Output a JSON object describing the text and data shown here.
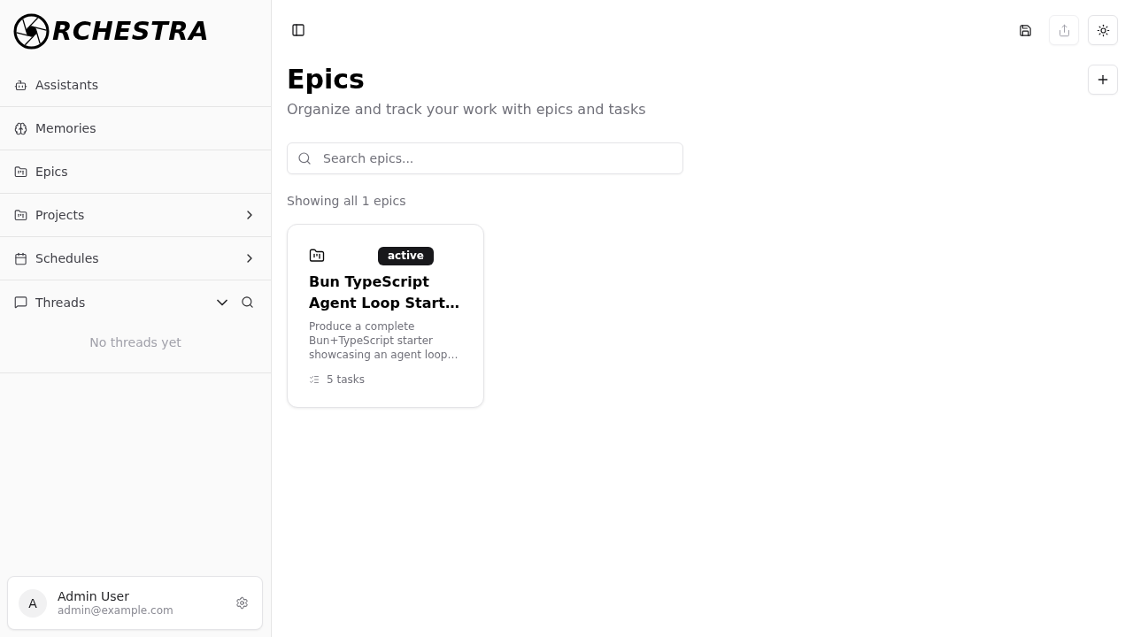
{
  "sidebar": {
    "logo": "RCHESTRA",
    "nav": [
      {
        "label": "Assistants",
        "kind": "link"
      },
      {
        "label": "Memories",
        "kind": "link"
      },
      {
        "label": "Epics",
        "kind": "link"
      },
      {
        "label": "Projects",
        "kind": "group",
        "expanded": false
      },
      {
        "label": "Schedules",
        "kind": "group",
        "expanded": false
      },
      {
        "label": "Threads",
        "kind": "section",
        "expanded": true,
        "empty_text": "No threads yet"
      }
    ],
    "user": {
      "initial": "A",
      "name": "Admin User",
      "email": "admin@example.com"
    }
  },
  "toolbar": [
    {
      "kind": "save",
      "disabled": false
    },
    {
      "kind": "share",
      "disabled": true
    },
    {
      "kind": "theme",
      "disabled": false
    }
  ],
  "page": {
    "title": "Epics",
    "subtitle": "Organize and track your work with epics and tasks",
    "search": {
      "placeholder": "Search epics..."
    },
    "count_text": "Showing all 1 epics"
  },
  "epics": [
    {
      "status": "active",
      "title": "Bun TypeScript Agent Loop Start…",
      "description": "Produce a complete Bun+TypeScript starter showcasing an agent loop…",
      "tasks": "5 tasks"
    }
  ]
}
